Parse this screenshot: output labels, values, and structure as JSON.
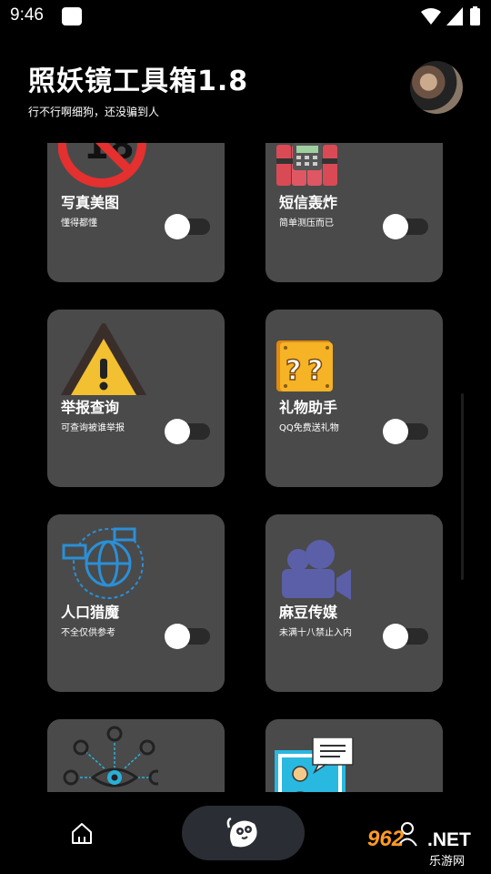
{
  "status_bar": {
    "time": "9:46"
  },
  "header": {
    "title": "照妖镜工具箱1.8",
    "subtitle": "行不行啊细狗，还没骗到人"
  },
  "cards": [
    {
      "name": "写真美图",
      "desc": "懂得都懂",
      "icon": "no-18-icon",
      "enabled": false
    },
    {
      "name": "短信轰炸",
      "desc": "简单测压而已",
      "icon": "dynamite-icon",
      "enabled": false
    },
    {
      "name": "举报查询",
      "desc": "可查询被谁举报",
      "icon": "warning-icon",
      "enabled": false
    },
    {
      "name": "礼物助手",
      "desc": "QQ免费送礼物",
      "icon": "question-block-icon",
      "enabled": false
    },
    {
      "name": "人口猎魔",
      "desc": "不全仅供参考",
      "icon": "globe-chat-icon",
      "enabled": false
    },
    {
      "name": "麻豆传媒",
      "desc": "未满十八禁止入内",
      "icon": "video-camera-icon",
      "enabled": false
    },
    {
      "name": "",
      "desc": "",
      "icon": "eye-network-icon",
      "enabled": false
    },
    {
      "name": "",
      "desc": "",
      "icon": "user-chat-icon",
      "enabled": false
    }
  ],
  "bottom_nav": {
    "items": [
      {
        "icon": "home-icon"
      },
      {
        "icon": "mascot-icon",
        "active": true
      },
      {
        "icon": "user-icon"
      }
    ]
  },
  "watermark": {
    "number": "962",
    "suffix": ".NET",
    "site": "乐游网"
  },
  "colors": {
    "background": "#000000",
    "card": "#4a4a4a",
    "toggle_track": "#2a2a2a",
    "nav_pill": "#2a2d33"
  }
}
